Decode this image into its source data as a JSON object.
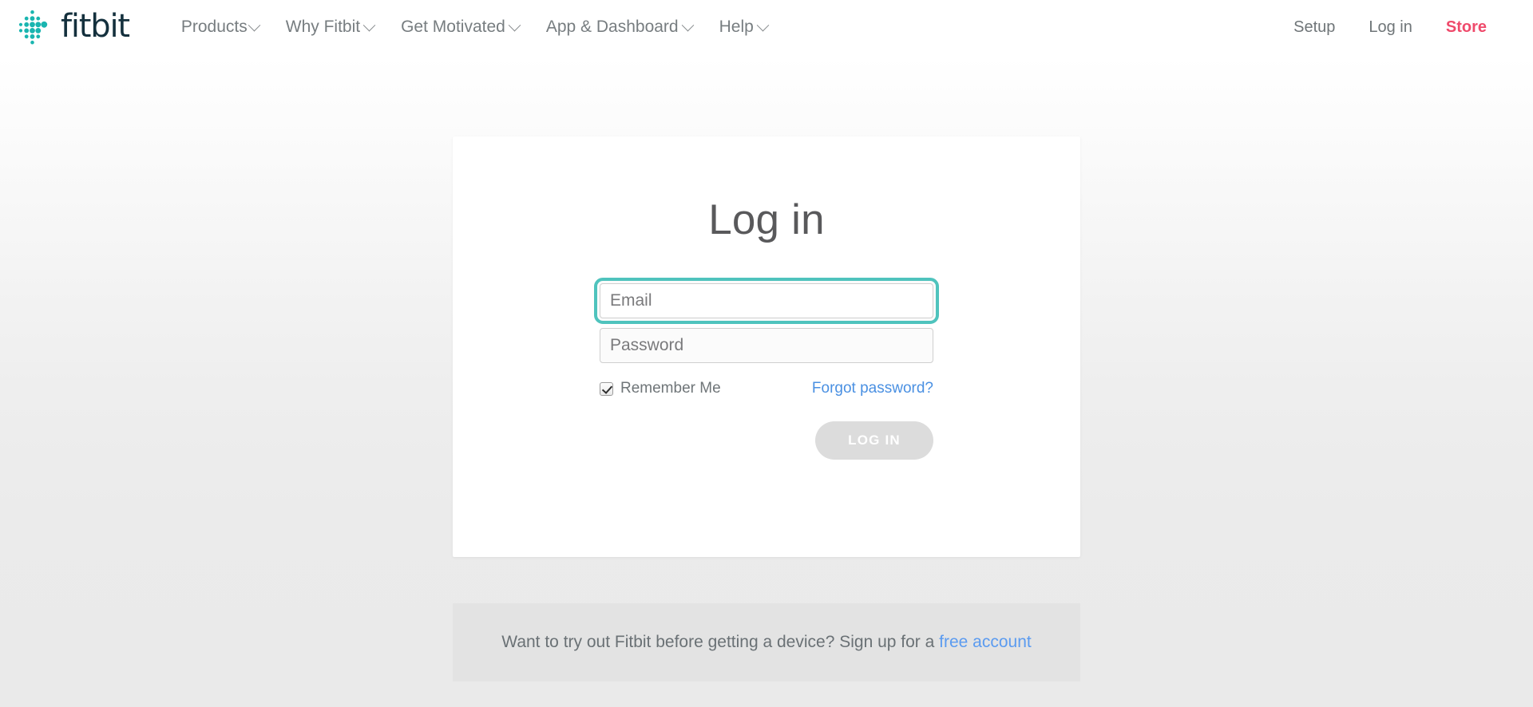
{
  "header": {
    "logo": {
      "icon": "fitbit-dots-logo-icon",
      "wordmark": "fitbit",
      "color": "#1ab5b0",
      "word_color": "#14303d"
    },
    "main_nav": [
      {
        "label": "Products",
        "has_dropdown": true
      },
      {
        "label": "Why Fitbit",
        "has_dropdown": true
      },
      {
        "label": "Get Motivated",
        "has_dropdown": true
      },
      {
        "label": "App & Dashboard",
        "has_dropdown": true
      },
      {
        "label": "Help",
        "has_dropdown": true
      }
    ],
    "utility_nav": [
      {
        "label": "Setup",
        "accent": false
      },
      {
        "label": "Log in",
        "accent": false
      },
      {
        "label": "Store",
        "accent": true,
        "color": "#ef4a6b"
      }
    ]
  },
  "login_card": {
    "title": "Log in",
    "email": {
      "placeholder": "Email",
      "value": "",
      "focused": true,
      "focus_ring_color": "#4fc3bd"
    },
    "password": {
      "placeholder": "Password",
      "value": "",
      "focused": false
    },
    "remember_me": {
      "label": "Remember Me",
      "checked": true
    },
    "forgot_password": {
      "label": "Forgot password?",
      "color": "#4a90e2"
    },
    "submit": {
      "label": "LOG IN",
      "disabled": true,
      "background": "#dcdcdc"
    }
  },
  "signup_banner": {
    "text": "Want to try out Fitbit before getting a device? Sign up for a ",
    "link_label": "free account",
    "link_color": "#5b9bf0",
    "background": "#e3e3e3"
  }
}
